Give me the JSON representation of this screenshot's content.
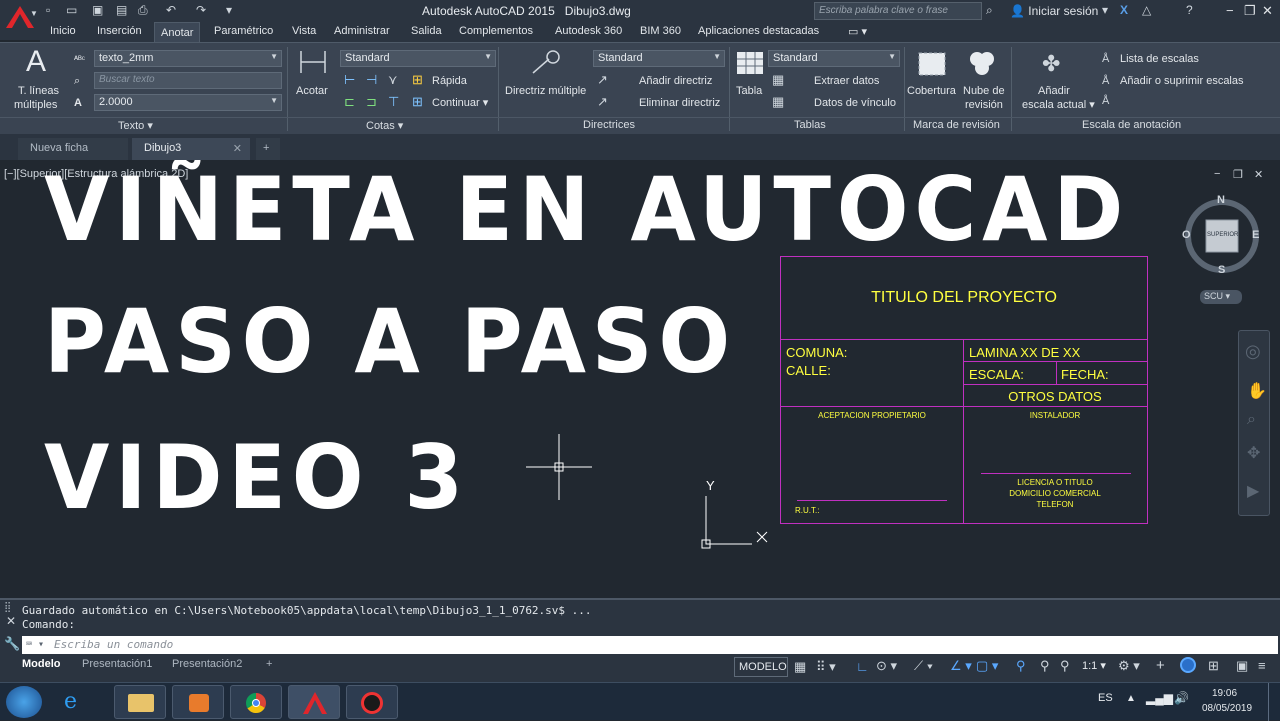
{
  "window": {
    "title": "Autodesk AutoCAD 2015",
    "document": "Dibujo3.dwg",
    "search_placeholder": "Escriba palabra clave o frase",
    "user_label": "Iniciar sesión"
  },
  "menu": [
    "Inicio",
    "Inserción",
    "Anotar",
    "Paramétrico",
    "Vista",
    "Administrar",
    "Salida",
    "Complementos",
    "Autodesk 360",
    "BIM 360",
    "Aplicaciones destacadas"
  ],
  "menu_active": "Anotar",
  "ribbon": {
    "texto": {
      "big_label_1": "T. líneas",
      "big_label_2": "múltiples",
      "style": "texto_2mm",
      "search": "Buscar texto",
      "height": "2.0000",
      "panel": "Texto"
    },
    "cotas": {
      "acotar": "Acotar",
      "style": "Standard",
      "rapida": "Rápida",
      "continuar": "Continuar",
      "panel": "Cotas"
    },
    "directrices": {
      "multi": "Directriz múltiple",
      "style": "Standard",
      "add": "Añadir directriz",
      "remove": "Eliminar directriz",
      "panel": "Directrices"
    },
    "tablas": {
      "tabla": "Tabla",
      "style": "Standard",
      "extract": "Extraer datos",
      "link": "Datos de vínculo",
      "panel": "Tablas"
    },
    "revision": {
      "cobertura": "Cobertura",
      "nube_1": "Nube de",
      "nube_2": "revisión",
      "panel": "Marca de revisión"
    },
    "escala": {
      "add_1": "Añadir",
      "add_2": "escala actual",
      "list": "Lista de escalas",
      "addremove": "Añadir o suprimir escalas",
      "panel": "Escala de anotación"
    }
  },
  "file_tabs": [
    "Nueva ficha",
    "Dibujo3"
  ],
  "viewport_label": "[−][Superior][Estructura alámbrica 2D]",
  "overlay": {
    "line1": "VIÑETA EN AUTOCAD",
    "line2": "PASO A PASO",
    "line3": "VIDEO 3"
  },
  "viewcube": {
    "n": "N",
    "s": "S",
    "e": "E",
    "w": "O",
    "face": "SUPERIOR",
    "ucs": "SCU"
  },
  "ucs_icon": {
    "x": "X",
    "y": "Y"
  },
  "title_block": {
    "project": "TITULO DEL PROYECTO",
    "comuna": "COMUNA:",
    "calle": "CALLE:",
    "lamina": "LAMINA XX DE XX",
    "escala": "ESCALA:",
    "fecha": "FECHA:",
    "otros": "OTROS DATOS",
    "aceptacion": "ACEPTACION PROPIETARIO",
    "rut": "R.U.T.:",
    "instalador": "INSTALADOR",
    "lic1": "LICENCIA O TITULO",
    "lic2": "DOMICILIO COMERCIAL",
    "lic3": "TELEFON"
  },
  "command": {
    "history_1": "Guardado automático en C:\\Users\\Notebook05\\appdata\\local\\temp\\Dibujo3_1_1_0762.sv$ ...",
    "history_2": "Comando:",
    "placeholder": "Escriba un comando"
  },
  "layout_tabs": [
    "Modelo",
    "Presentación1",
    "Presentación2"
  ],
  "status": {
    "mode": "MODELO",
    "scale": "1:1"
  },
  "tray": {
    "lang": "ES",
    "time": "19:06",
    "date": "08/05/2019"
  }
}
